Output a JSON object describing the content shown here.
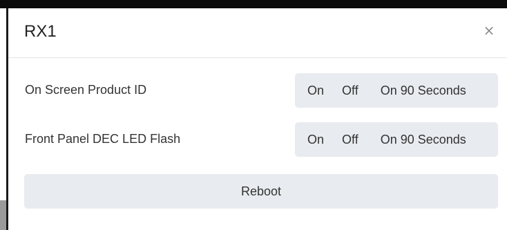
{
  "modal": {
    "title": "RX1",
    "close_glyph": "×",
    "close_icon": "close-icon"
  },
  "settings": [
    {
      "label": "On Screen Product ID",
      "options": [
        "On",
        "Off",
        "On 90 Seconds"
      ]
    },
    {
      "label": "Front Panel DEC LED Flash",
      "options": [
        "On",
        "Off",
        "On 90 Seconds"
      ]
    }
  ],
  "actions": {
    "reboot_label": "Reboot"
  },
  "colors": {
    "segment_bg": "#e8ebef",
    "text": "#333333",
    "close_icon": "#8a8a8a"
  }
}
